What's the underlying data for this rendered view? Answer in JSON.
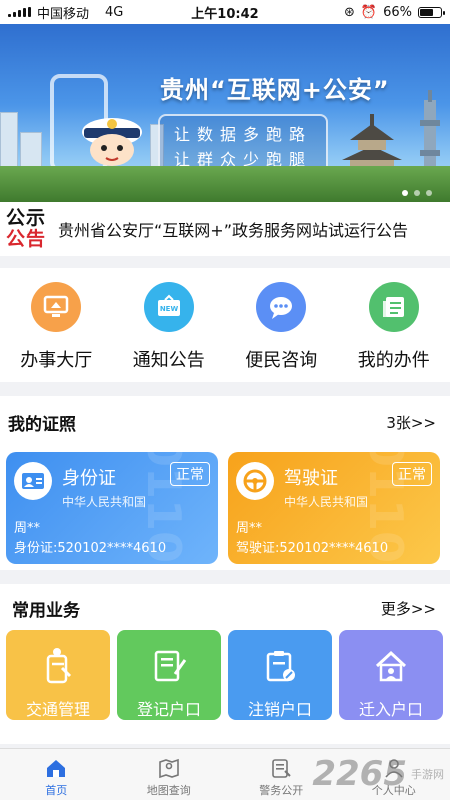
{
  "status_bar": {
    "carrier": "中国移动",
    "network": "4G",
    "time": "上午10:42",
    "battery": "66%",
    "battery_level": 0.66
  },
  "banner": {
    "title": "贵州“互联网+公安”",
    "subtitle_line1": "让数据多跑路",
    "subtitle_line2": "让群众少跑腿",
    "slide_count": 3,
    "active_slide": 1
  },
  "notice": {
    "badge_line1": "公示",
    "badge_line2": "公告",
    "text": "贵州省公安厅“互联网+”政务服务网站试运行公告"
  },
  "quick_menu": [
    {
      "label": "办事大厅",
      "icon": "monitor-home-icon",
      "color": "#f7a14a"
    },
    {
      "label": "通知公告",
      "icon": "new-board-icon",
      "color": "#36b3ec"
    },
    {
      "label": "便民咨询",
      "icon": "chat-bubble-icon",
      "color": "#5b8ff5"
    },
    {
      "label": "我的办件",
      "icon": "document-icon",
      "color": "#52c06e"
    }
  ],
  "certificates": {
    "title": "我的证照",
    "more": "3张>>",
    "cards": [
      {
        "type": "身份证",
        "status": "正常",
        "issuer": "中华人民共和国",
        "name": "周**",
        "number": "身份证:520102****4610",
        "color": "#3e8ff0",
        "icon": "id-card-icon"
      },
      {
        "type": "驾驶证",
        "status": "正常",
        "issuer": "中华人民共和国",
        "name": "周**",
        "number": "驾驶证:520102****4610",
        "color": "#f7a21b",
        "icon": "steering-wheel-icon"
      }
    ]
  },
  "services": {
    "title": "常用业务",
    "more": "更多>>",
    "items": [
      {
        "label": "交通管理",
        "icon": "traffic-officer-icon",
        "color": "#f8c247"
      },
      {
        "label": "登记户口",
        "icon": "register-notebook-icon",
        "color": "#62c95d"
      },
      {
        "label": "注销户口",
        "icon": "cancel-clipboard-icon",
        "color": "#4a9bf0"
      },
      {
        "label": "迁入户口",
        "icon": "move-in-house-icon",
        "color": "#8b8ff2"
      }
    ]
  },
  "tabs": [
    {
      "label": "首页",
      "icon": "home-icon",
      "active": true
    },
    {
      "label": "地图查询",
      "icon": "map-icon",
      "active": false
    },
    {
      "label": "警务公开",
      "icon": "police-bulletin-icon",
      "active": false
    },
    {
      "label": "个人中心",
      "icon": "person-icon",
      "active": false
    }
  ],
  "watermark": {
    "number": "2265",
    "line1": "手游网",
    "line2": ""
  }
}
